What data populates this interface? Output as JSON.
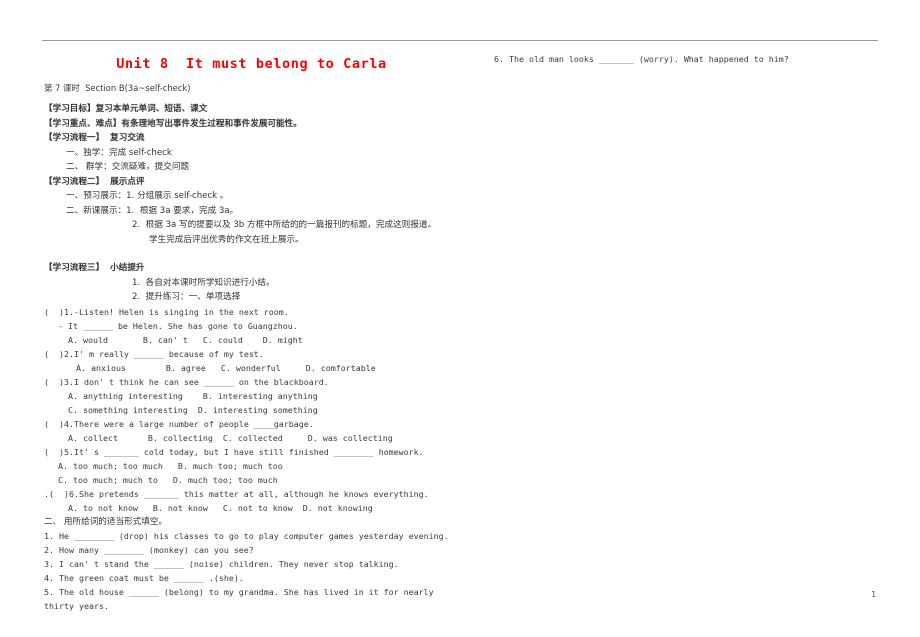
{
  "document": {
    "title": "Unit 8  It must belong to Carla",
    "subheading": "第 7 课时  Section B(3a~self-check)",
    "page_number": "1"
  },
  "objectives": {
    "goal": "【学习目标】复习本单元单词、短语、课文",
    "focus": "【学习重点、难点】有条理地写出事件发生过程和事件发展可能性。"
  },
  "process_one": {
    "heading": "【学习流程一】  复习交流",
    "items": [
      "一、独学：完成 self-check",
      "二、 群学：交流疑难，提交问题"
    ]
  },
  "process_two": {
    "heading": "【学习流程二】  展示点评",
    "items": [
      "一、预习展示：1. 分组展示 self-check 。",
      "二、新课展示：1.  根据 3a 要求，完成 3a。",
      "2.  根据 3a 写的提要以及 3b 方框中所给的的一篇报刊的标题，完成这则报道。",
      "学生完成后评出优秀的作文在班上展示。"
    ]
  },
  "process_three": {
    "heading": "【学习流程三】  小结提升",
    "items": [
      "1.  各自对本课时所学知识进行小结。",
      "2.  提升练习：一、单项选择"
    ]
  },
  "multiple_choice": {
    "questions": [
      {
        "marker": "(  )1.",
        "stem_lines": [
          "-Listen! Helen is singing in the next room.",
          "- It ______ be Helen. She has gone to Guangzhou."
        ],
        "options_lines": [
          "A. would       B. can' t   C. could    D. might"
        ]
      },
      {
        "marker": "(  )2.",
        "stem_lines": [
          "I' m really ______ because of my test."
        ],
        "options_lines": [
          "A. anxious        B. agree   C. wonderful     D. comfortable"
        ]
      },
      {
        "marker": "(  )3.",
        "stem_lines": [
          "I don' t think he can see ______ on the blackboard."
        ],
        "options_lines": [
          "A. anything interesting    B. interesting anything",
          "C. something interesting  D. interesting something"
        ]
      },
      {
        "marker": "(  )4.",
        "stem_lines": [
          "There were a large number of people ____garbage."
        ],
        "options_lines": [
          "A. collect      B. collecting  C. collected     D. was collecting"
        ]
      },
      {
        "marker": "(  )5.",
        "stem_lines": [
          "It' s _______ cold today, but I have still finished ________ homework."
        ],
        "options_lines": [
          "A. too much; too much   B. much too; much too",
          "C. too much; much to   D. much too; too much"
        ]
      },
      {
        "marker": ".(  )6.",
        "stem_lines": [
          "She pretends _______ this matter at all, although he knows everything."
        ],
        "options_lines": [
          "A. to not know   B. not know   C. not to know  D. not knowing"
        ]
      }
    ]
  },
  "fill_in_blanks": {
    "heading": "二、 用所给词的适当形式填空。",
    "questions": [
      "1. He ________ (drop) his classes to go to play computer games yesterday evening.",
      "2. How many ________ (monkey) can you see?",
      "3. I can' t stand the ______ (noise) children. They never stop talking.",
      "4. The green coat must be ______ .(she).",
      "5. The old house ______ (belong) to my grandma. She has lived in it for nearly thirty years.",
      "6. The old man looks _______ (worry). What happened to him?"
    ]
  },
  "colors": {
    "title_red": "#ff0000",
    "body_text": "#3a3a3a",
    "rule": "#9a9a9a"
  }
}
